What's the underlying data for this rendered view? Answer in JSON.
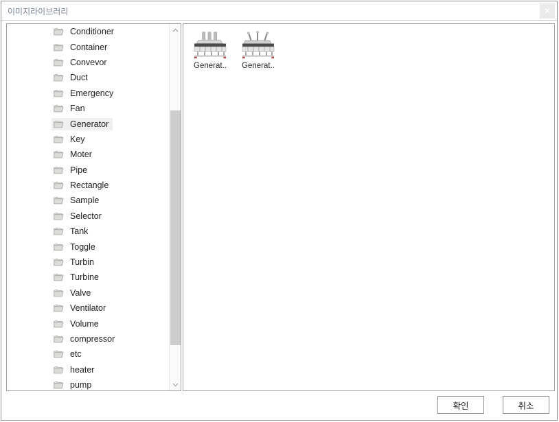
{
  "window": {
    "title": "이미지라이브러리",
    "close_icon": "close-icon",
    "close_glyph": "✕"
  },
  "tree": {
    "scrollbar": {
      "up_icon": "chevron-up-icon",
      "down_icon": "chevron-down-icon"
    },
    "items": [
      {
        "label": "Conditioner",
        "icon": "folder-icon",
        "selected": false
      },
      {
        "label": "Container",
        "icon": "folder-icon",
        "selected": false
      },
      {
        "label": "Convevor",
        "icon": "folder-icon",
        "selected": false
      },
      {
        "label": "Duct",
        "icon": "folder-icon",
        "selected": false
      },
      {
        "label": "Emergency",
        "icon": "folder-icon",
        "selected": false
      },
      {
        "label": "Fan",
        "icon": "folder-icon",
        "selected": false
      },
      {
        "label": "Generator",
        "icon": "folder-icon",
        "selected": true
      },
      {
        "label": "Key",
        "icon": "folder-icon",
        "selected": false
      },
      {
        "label": "Moter",
        "icon": "folder-icon",
        "selected": false
      },
      {
        "label": "Pipe",
        "icon": "folder-icon",
        "selected": false
      },
      {
        "label": "Rectangle",
        "icon": "folder-icon",
        "selected": false
      },
      {
        "label": "Sample",
        "icon": "folder-icon",
        "selected": false
      },
      {
        "label": "Selector",
        "icon": "folder-icon",
        "selected": false
      },
      {
        "label": "Tank",
        "icon": "folder-icon",
        "selected": false
      },
      {
        "label": "Toggle",
        "icon": "folder-icon",
        "selected": false
      },
      {
        "label": "Turbin",
        "icon": "folder-icon",
        "selected": false
      },
      {
        "label": "Turbine",
        "icon": "folder-icon",
        "selected": false
      },
      {
        "label": "Valve",
        "icon": "folder-icon",
        "selected": false
      },
      {
        "label": "Ventilator",
        "icon": "folder-icon",
        "selected": false
      },
      {
        "label": "Volume",
        "icon": "folder-icon",
        "selected": false
      },
      {
        "label": "compressor",
        "icon": "folder-icon",
        "selected": false
      },
      {
        "label": "etc",
        "icon": "folder-icon",
        "selected": false
      },
      {
        "label": "heater",
        "icon": "folder-icon",
        "selected": false
      },
      {
        "label": "pump",
        "icon": "folder-icon",
        "selected": false
      }
    ]
  },
  "content": {
    "thumbnails": [
      {
        "label": "Generat..",
        "icon": "generator-straight-icon"
      },
      {
        "label": "Generat..",
        "icon": "generator-angled-icon"
      }
    ]
  },
  "footer": {
    "ok_label": "확인",
    "cancel_label": "취소"
  },
  "colors": {
    "selection": "#f0f0f0",
    "title_text": "#7b849a",
    "panel_border": "#a0a0a0",
    "scroll_thumb": "#cdcdcd"
  }
}
